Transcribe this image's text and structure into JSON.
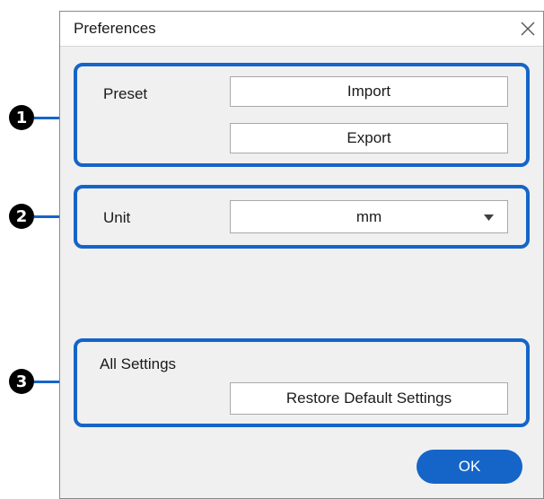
{
  "dialog": {
    "title": "Preferences",
    "close_icon": "close-icon"
  },
  "preset": {
    "label": "Preset",
    "import_label": "Import",
    "export_label": "Export"
  },
  "unit": {
    "label": "Unit",
    "selected": "mm",
    "dropdown_icon": "caret-down-icon"
  },
  "all_settings": {
    "label": "All Settings",
    "restore_label": "Restore Default Settings"
  },
  "ok_label": "OK",
  "callouts": [
    "1",
    "2",
    "3"
  ],
  "colors": {
    "accent": "#1565c8",
    "dialog_bg": "#f0f0f0",
    "callout_bg": "#000000"
  }
}
